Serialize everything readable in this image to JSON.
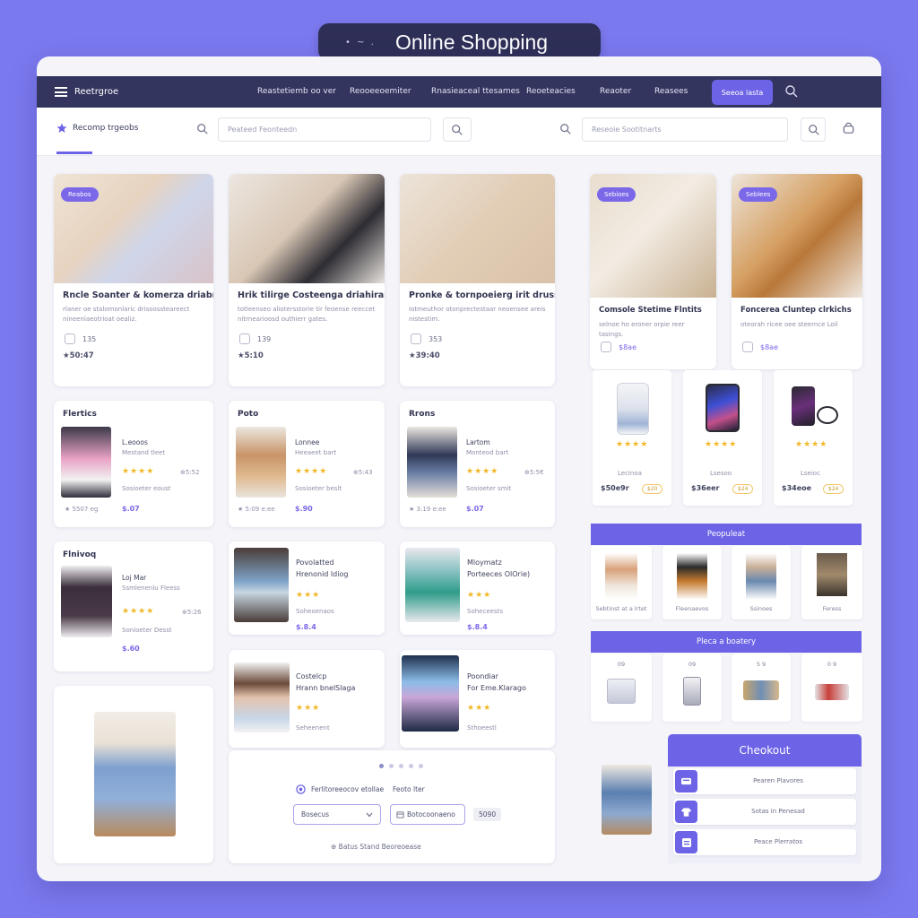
{
  "app": {
    "title": "Online Shopping",
    "title_dots": "• ~ ."
  },
  "navbar": {
    "brand": "Reetrgroe",
    "items": [
      "Reastetiemb oo ver",
      "Reooeeoemiter",
      "Rnasieaceal ttesames",
      "Reoeteacies",
      "Reaoter",
      "Reasees"
    ],
    "cta": "Seeoa lasta"
  },
  "searchbar": {
    "home_tab": "Recomp trgeobs",
    "search_left_placeholder": "Peateed Feonteedn",
    "search_right_placeholder": "Reseoie Sootitnarts"
  },
  "featured": [
    {
      "badge": "Reabos",
      "title": "Rncle Soanter & komerza driabnes",
      "desc": "rlaner oe stalomonlaric drisoossteareect nineenlaeotrioat oealiz.",
      "qty": "135",
      "price": "★50:47"
    },
    {
      "title": "Hrik tilirge Costeenga driahiras",
      "desc": "totleenseo aliotersstorie tir feoense reeccet nitrnearioosd outhierr gates.",
      "qty": "139",
      "price": "★5:10"
    },
    {
      "title": "Pronke & tornpoeierg irit drusse",
      "desc": "Iotmeuthor otonprectestaar neoensee areis nistestim.",
      "qty": "353",
      "price": "★39:40"
    },
    {
      "badge": "Sebioes",
      "title": "Comsole Stetime Flntits",
      "desc": "selnoe ho eroner orpie reer tasings.",
      "qty": "$8ae",
      "qty_label": ""
    },
    {
      "badge": "Seblees",
      "title": "Foncerea Cluntep clrkichs",
      "desc": "oteorah ricee oee steernce Loil",
      "qty": "$8ae"
    }
  ],
  "sections": [
    {
      "heading": "Flertics",
      "name": "L.eooos",
      "sub": "Mestand tleet",
      "stars": "★★★★",
      "count": "⊕5:52",
      "sub2": "Sosioeter eoust",
      "rating": "★ 5507 eg",
      "price": "$.07"
    },
    {
      "heading": "Poto",
      "name": "Lonnee",
      "sub": "Heeaeet bart",
      "stars": "★★★★",
      "count": "⊕5:43",
      "sub2": "Sosioeter beslt",
      "rating": "★ 5:09 e:ee",
      "price": "$.90"
    },
    {
      "heading": "Rrons",
      "name": "Lartom",
      "sub": "Monteod bart",
      "stars": "★★★★",
      "count": "⊕5:5€",
      "sub2": "Sosioeter smit",
      "rating": "★ 3:19 e:ee",
      "price": "$.07"
    },
    {
      "heading": "Flnivoq",
      "name": "Loj Mar",
      "sub": "Ssmlenenlu Fleess",
      "stars": "★★★★",
      "count": "⊕5:26",
      "sub2": "Sonioeter Desst",
      "price": "$.60"
    }
  ],
  "middle_items": [
    {
      "name": "Povolatted",
      "name2": "Hrenonid ldiog",
      "stars": "★★★",
      "sub": "Soheoenaos",
      "price": "$.8.4"
    },
    {
      "name": "Mloymatz",
      "name2": "Porteeces OlOrie)",
      "stars": "★★★",
      "sub": "Soheceests",
      "price": "$.8.4"
    },
    {
      "name": "Costelcp",
      "name2": "Hrann bnelSlaga",
      "stars": "★★★",
      "sub": "Seheenent"
    },
    {
      "name": "Poondiar",
      "name2": "For Eme.Klarago",
      "stars": "★★★",
      "sub": "Sthoeestl"
    }
  ],
  "devices": [
    {
      "stars": "★★★★",
      "name": "Lecinoa",
      "price": "$50e9r",
      "tag": "$20"
    },
    {
      "stars": "★★★★",
      "name": "Lsesoo",
      "price": "$36eer",
      "tag": "$24"
    },
    {
      "stars": "★★★★",
      "name": "Lseioc",
      "price": "$34eoe",
      "tag": "$24"
    }
  ],
  "popular": {
    "header": "Peopuleat",
    "items": [
      "Sebtinst at a lrtet",
      "Fleenaevos",
      "Ssinoes",
      "Feress"
    ]
  },
  "favorites": {
    "header": "Pleca a boatery",
    "labels": [
      "09",
      "09",
      "5 9",
      "0 9"
    ]
  },
  "checkout": {
    "header": "Cheokout",
    "rows": [
      "Pearen Plavores",
      "Sotas in Penesad",
      "Peace Plerratos"
    ]
  },
  "filter_panel": {
    "filter_label": "Ferlitoreeocov etollae",
    "filter_value": "Feoto lter",
    "select_label": "Bosecus",
    "button_label": "Botocoonaeno",
    "count": "5090",
    "note": "⊕ Batus Stand Beoreoease"
  },
  "colors": {
    "accent": "#6c63e6",
    "navbar": "#34355f",
    "background": "#7b79ee",
    "star": "#f2b825"
  },
  "icons": [
    "menu-icon",
    "star-icon",
    "search-icon",
    "cart-icon",
    "chevron-down-icon",
    "filter-icon",
    "calendar-icon"
  ]
}
